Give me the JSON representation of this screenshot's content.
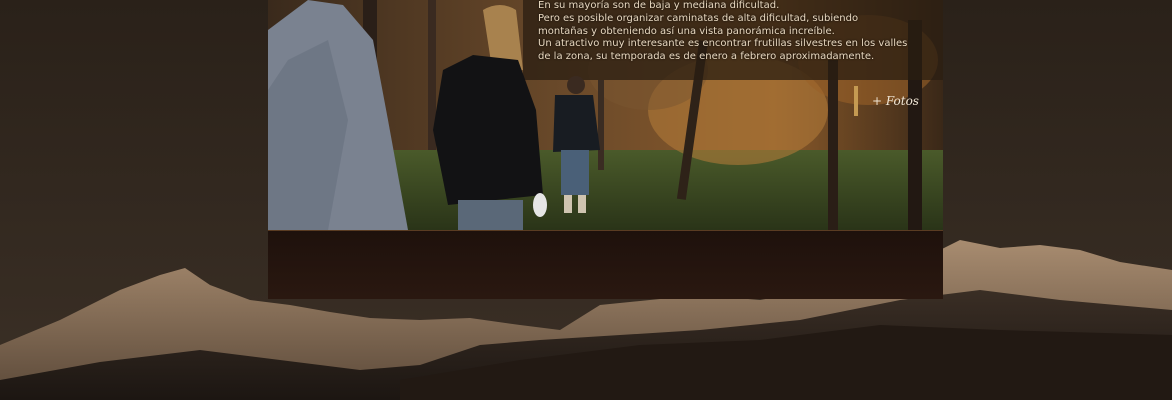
{
  "caption": {
    "lines": [
      "En su mayoría son de baja y mediana dificultad.",
      "Pero es posible organizar caminatas de alta dificultad, subiendo",
      "montañas y obteniendo así una vista panorámica increíble.",
      "Un atractivo muy interesante es encontrar frutillas silvestres en los valles",
      "de la zona, su temporada es de enero a febrero aproximadamente."
    ]
  },
  "photos_link": {
    "label": "+ Fotos"
  },
  "colors": {
    "accent": "#c59a52",
    "background": "#2f2720",
    "panel": "#1e110c"
  }
}
